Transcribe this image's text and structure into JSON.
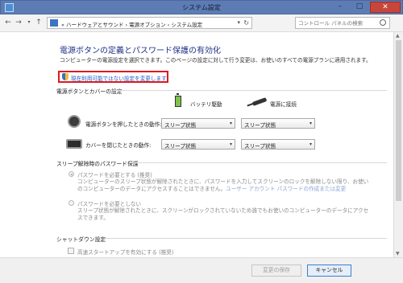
{
  "window": {
    "title": "システム設定"
  },
  "address": {
    "crumbs": "« ハードウェアとサウンド ›  電源オプション ›  システム設定",
    "search_placeholder": "コントロール パネルの検索"
  },
  "main": {
    "heading": "電源ボタンの定義とパスワード保護の有効化",
    "description": "コンピューターの電源設定を選択できます。このページの設定に対して行う変更は、お使いのすべての電源プランに適用されます。",
    "change_link": "現在利用可能ではない設定を変更します"
  },
  "power_section": {
    "title": "電源ボタンとカバーの設定",
    "col_battery": "バッテリ駆動",
    "col_plugged": "電源に接続",
    "rows": [
      {
        "label": "電源ボタンを押したときの動作:",
        "battery": "スリープ状態",
        "plugged": "スリープ状態"
      },
      {
        "label": "カバーを閉じたときの動作:",
        "battery": "スリープ状態",
        "plugged": "スリープ状態"
      }
    ]
  },
  "password_section": {
    "title": "スリープ解除時のパスワード保護",
    "opt_required": "パスワードを必要とする (推奨)",
    "opt_required_desc_1": "コンピューターのスリープ状態が解除されたときに、パスワードを入力してスクリーンのロックを解除しない限り、お使い",
    "opt_required_desc_2": "のコンピューターのデータにアクセスすることはできません。",
    "opt_required_link": "ユーザー アカウント パスワードの作成または変更",
    "opt_none": "パスワードを必要としない",
    "opt_none_desc_1": "スリープ状態が解除されたときに、スクリーンがロックされていないため誰でもお使いのコンピューターのデータにアクセ",
    "opt_none_desc_2": "スできます。"
  },
  "shutdown_section": {
    "title": "シャットダウン設定",
    "fast_startup": "高速スタートアップを有効にする (推奨)"
  },
  "footer": {
    "save_label": "変更の保存",
    "cancel_label": "キャンセル"
  }
}
